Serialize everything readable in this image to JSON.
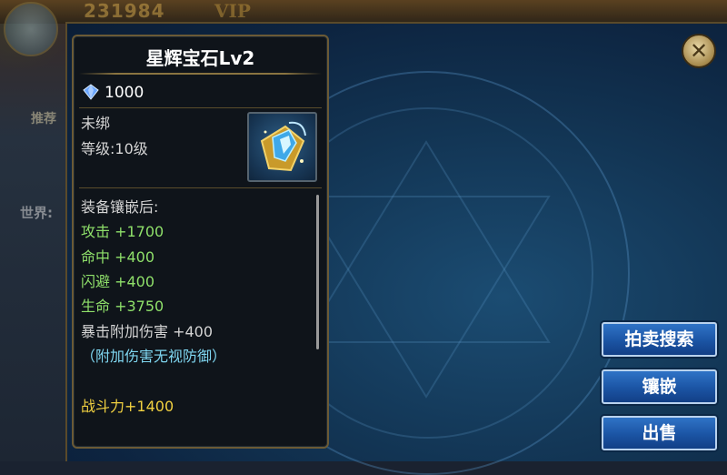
{
  "background": {
    "score": "231984",
    "vip": "VIP",
    "recommend_label": "推荐",
    "world_label": "世界:"
  },
  "tooltip": {
    "title": "星辉宝石Lv2",
    "price": "1000",
    "price_icon": "gem-icon",
    "bind_status": "未绑",
    "level": "等级:10级",
    "stats_header": "装备镶嵌后:",
    "stats": [
      {
        "text": "攻击 +1700"
      },
      {
        "text": "命中 +400"
      },
      {
        "text": "闪避 +400"
      },
      {
        "text": "生命 +3750"
      }
    ],
    "crit_bonus": "暴击附加伤害 +400",
    "ignore_defense": "（附加伤害无视防御）",
    "combat_power": "战斗力+1400"
  },
  "actions": {
    "auction_search": "拍卖搜索",
    "inlay": "镶嵌",
    "sell": "出售",
    "close_icon": "close-icon"
  },
  "colors": {
    "stat_green": "#8fe06a",
    "note_cyan": "#7fd6f0",
    "power_yellow": "#f0d040",
    "button_blue": "#1b54a4"
  }
}
